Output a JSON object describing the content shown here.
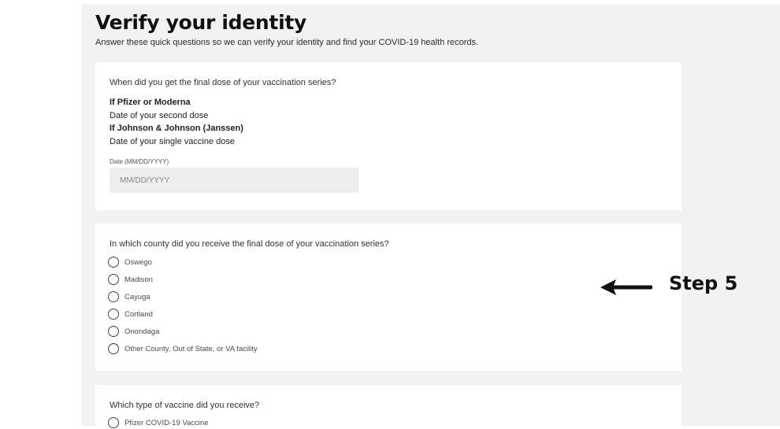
{
  "page": {
    "title": "Verify your identity",
    "subtitle": "Answer these quick questions so we can verify your identity and find your COVID-19 health records."
  },
  "dose_question": {
    "question": "When did you get the final dose of your vaccination series?",
    "pfizer_heading": "If Pfizer or Moderna",
    "pfizer_text": "Date of your second dose",
    "jj_heading": "If Johnson & Johnson (Janssen)",
    "jj_text": "Date of your single vaccine dose",
    "date_label": "Date (MM/DD/YYYY)",
    "date_placeholder": "MM/DD/YYYY",
    "date_value": ""
  },
  "county_question": {
    "question": "In which county did you receive the final dose of your vaccination series?",
    "options": [
      "Oswego",
      "Madison",
      "Cayuga",
      "Cortland",
      "Onondaga",
      "Other County, Out of State, or VA facility"
    ]
  },
  "vaccine_question": {
    "question": "Which type of vaccine did you receive?",
    "options": [
      "Pfizer COVID-19 Vaccine"
    ]
  },
  "annotation": {
    "label": "Step 5",
    "arrow_icon": "left-arrow-icon"
  },
  "colors": {
    "page_background": "#f2f2f2",
    "card_background": "#ffffff",
    "input_background": "#ededed",
    "text": "#1a1a1a"
  }
}
